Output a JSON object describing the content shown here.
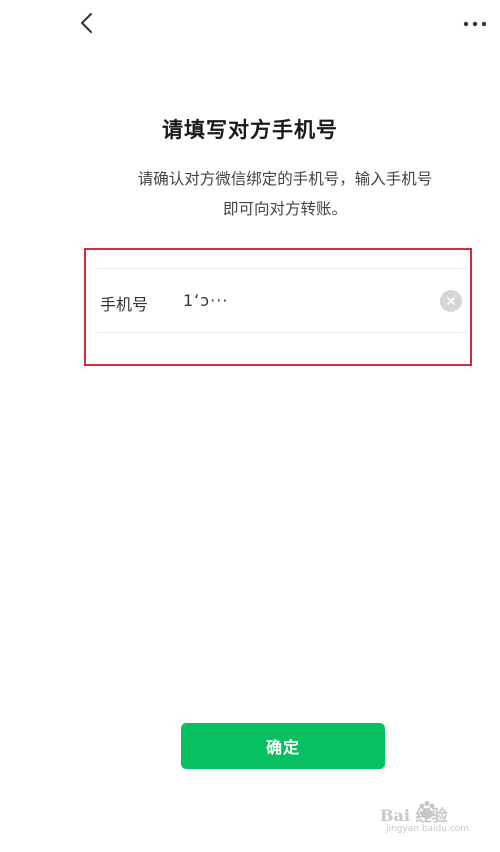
{
  "header": {
    "back_icon": "chevron-left-icon",
    "more_icon": "more-horizontal-icon"
  },
  "main": {
    "title": "请填写对方手机号",
    "subtitle_line1": "请确认对方微信绑定的手机号，输入手机号",
    "subtitle_line2": "即可向对方转账。"
  },
  "form": {
    "phone_label": "手机号",
    "phone_value": "1ʻɔ⋅⋅⋅",
    "clear_icon": "clear-icon"
  },
  "footer": {
    "confirm_label": "确定"
  },
  "watermark": {
    "brand": "Bai  经验",
    "url": "jingyan.baidu.com"
  },
  "colors": {
    "accent": "#07c160",
    "highlight_border": "#d12b3c"
  }
}
